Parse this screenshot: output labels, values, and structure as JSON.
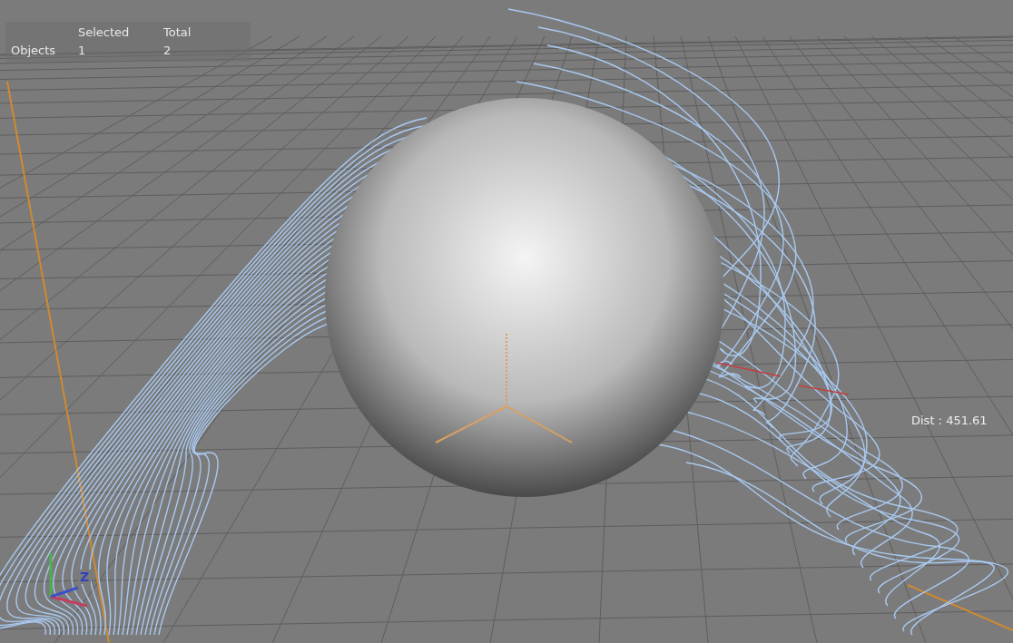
{
  "viewport": {
    "hud": {
      "columns": [
        "Selected",
        "Total"
      ],
      "rows": [
        {
          "label": "Objects",
          "selected": "1",
          "total": "2"
        }
      ]
    },
    "distance_readout": "Dist : 451.61",
    "axis_gizmo": {
      "label": "Z"
    }
  }
}
